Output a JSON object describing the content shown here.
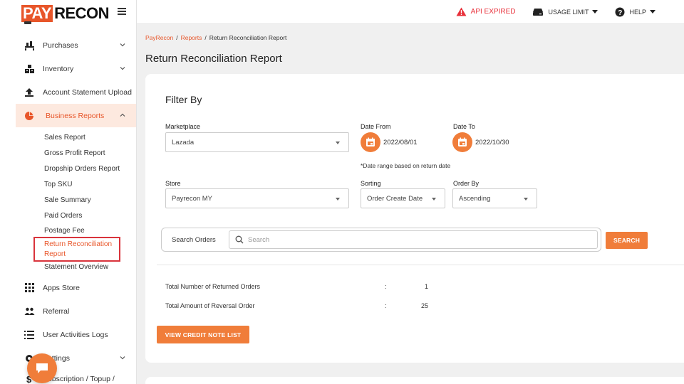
{
  "brand": {
    "pay": "PAY",
    "recon": "RECON"
  },
  "topbar": {
    "api_status": "API EXPIRED",
    "usage_limit": "USAGE LIMIT",
    "help": "HELP"
  },
  "sidebar": {
    "items": [
      {
        "label": "Purchases",
        "icon": "purchases-icon"
      },
      {
        "label": "Inventory",
        "icon": "inventory-icon"
      },
      {
        "label": "Account Statement Upload",
        "icon": "upload-icon"
      },
      {
        "label": "Business Reports",
        "icon": "pie-chart-icon"
      }
    ],
    "business_reports_sub": [
      "Sales Report",
      "Gross Profit Report",
      "Dropship Orders Report",
      "Top SKU",
      "Sale Summary",
      "Paid Orders",
      "Postage Fee",
      "Return Reconciliation Report",
      "Statement Overview"
    ],
    "items_after": [
      {
        "label": "Apps Store",
        "icon": "apps-grid-icon"
      },
      {
        "label": "Referral",
        "icon": "referral-icon"
      },
      {
        "label": "User Activities Logs",
        "icon": "list-icon"
      },
      {
        "label": "Settings",
        "icon": "gear-icon"
      },
      {
        "label": "Subscription / Topup /",
        "icon": "dollar-icon"
      }
    ]
  },
  "breadcrumb": [
    "PayRecon",
    "Reports",
    "Return Reconciliation Report"
  ],
  "page_title": "Return Reconciliation Report",
  "filter": {
    "title": "Filter By",
    "marketplace_label": "Marketplace",
    "marketplace_value": "Lazada",
    "date_from_label": "Date From",
    "date_from_value": "2022/08/01",
    "date_to_label": "Date To",
    "date_to_value": "2022/10/30",
    "date_note": "*Date range based on return date",
    "store_label": "Store",
    "store_value": "Payrecon MY",
    "sorting_label": "Sorting",
    "sorting_value": "Order Create Date",
    "order_by_label": "Order By",
    "order_by_value": "Ascending"
  },
  "search": {
    "label": "Search Orders",
    "placeholder": "Search",
    "button": "SEARCH"
  },
  "stats": {
    "returned_label": "Total Number of Returned Orders",
    "returned_value": "1",
    "reversal_label": "Total Amount of Reversal Order",
    "reversal_value": "25",
    "colon": ":"
  },
  "credit_note_button": "VIEW CREDIT NOTE LIST",
  "colors": {
    "accent": "#f07d3a",
    "brand": "#e8562a",
    "alert": "#e8303a"
  }
}
